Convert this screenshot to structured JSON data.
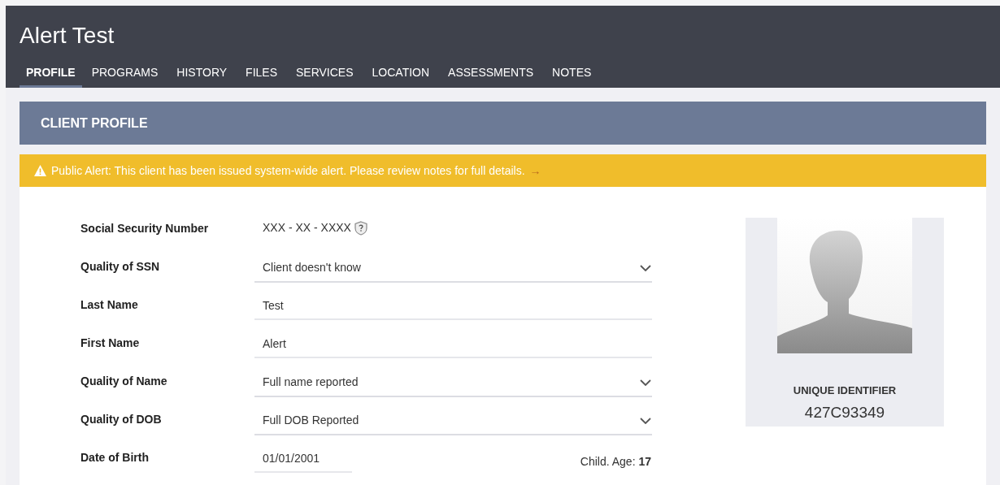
{
  "header": {
    "title": "Alert Test"
  },
  "tabs": [
    {
      "label": "PROFILE",
      "selected": true
    },
    {
      "label": "PROGRAMS",
      "selected": false
    },
    {
      "label": "HISTORY",
      "selected": false
    },
    {
      "label": "FILES",
      "selected": false
    },
    {
      "label": "SERVICES",
      "selected": false
    },
    {
      "label": "LOCATION",
      "selected": false
    },
    {
      "label": "ASSESSMENTS",
      "selected": false
    },
    {
      "label": "NOTES",
      "selected": false
    }
  ],
  "section": {
    "title": "CLIENT PROFILE"
  },
  "alert": {
    "text": "Public Alert: This client has been issued system-wide alert. Please review notes for full details.",
    "link": "→"
  },
  "fields": [
    {
      "kind": "masked",
      "label": "Social Security Number",
      "value": "XXX - XX - XXXX"
    },
    {
      "kind": "select",
      "label": "Quality of SSN",
      "value": "Client doesn't know"
    },
    {
      "kind": "input",
      "label": "Last Name",
      "value": "Test"
    },
    {
      "kind": "input",
      "label": "First Name",
      "value": "Alert"
    },
    {
      "kind": "select",
      "label": "Quality of Name",
      "value": "Full name reported"
    },
    {
      "kind": "select",
      "label": "Quality of DOB",
      "value": "Full DOB Reported"
    },
    {
      "kind": "date",
      "label": "Date of Birth",
      "value": "01/01/2001",
      "age_label": "Child. Age:",
      "age": "17"
    }
  ],
  "id_card": {
    "label": "UNIQUE IDENTIFIER",
    "value": "427C93349"
  }
}
